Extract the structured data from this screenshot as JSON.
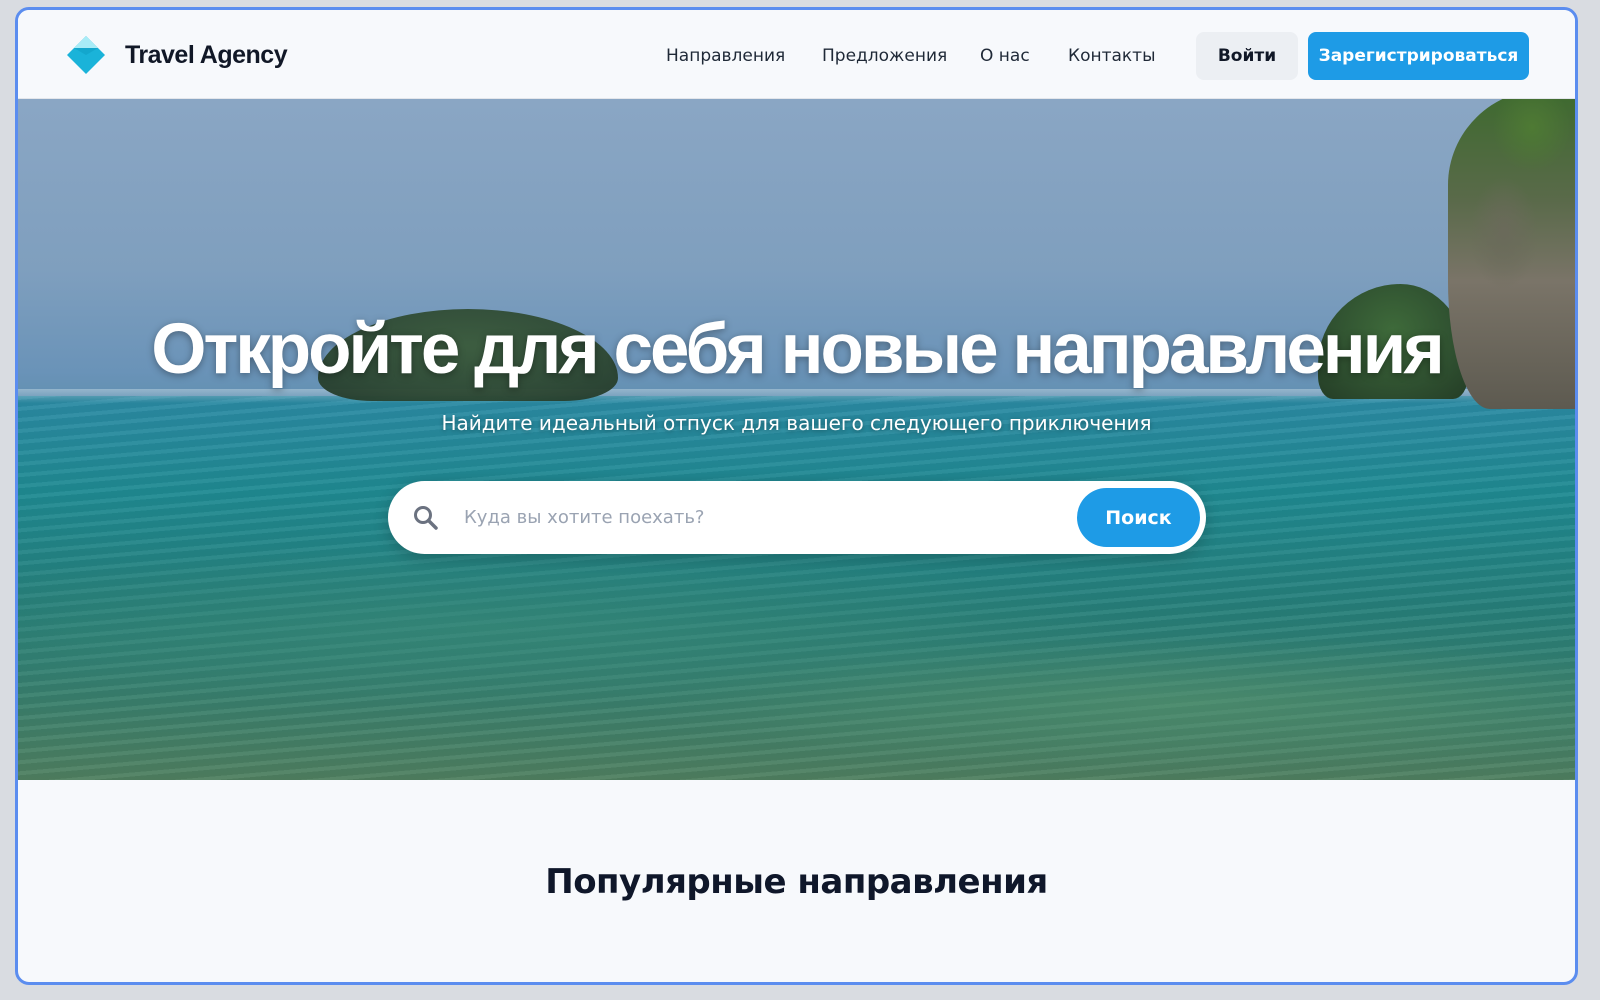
{
  "header": {
    "brand": "Travel Agency",
    "nav": [
      "Направления",
      "Предложения",
      "О нас",
      "Контакты"
    ],
    "login_label": "Войти",
    "register_label": "Зарегистрироваться"
  },
  "hero": {
    "title": "Откройте для себя новые направления",
    "subtitle": "Найдите идеальный отпуск для вашего следующего приключения",
    "search": {
      "placeholder": "Куда вы хотите поехать?",
      "value": "",
      "button_label": "Поиск"
    }
  },
  "popular": {
    "title": "Популярные направления"
  },
  "colors": {
    "accent": "#1e9be6",
    "logo": "#1ab3d9",
    "text_dark": "#0f172a",
    "frame_border": "#5b8def"
  },
  "icons": {
    "logo": "diamond-logo-icon",
    "search": "search-icon"
  }
}
